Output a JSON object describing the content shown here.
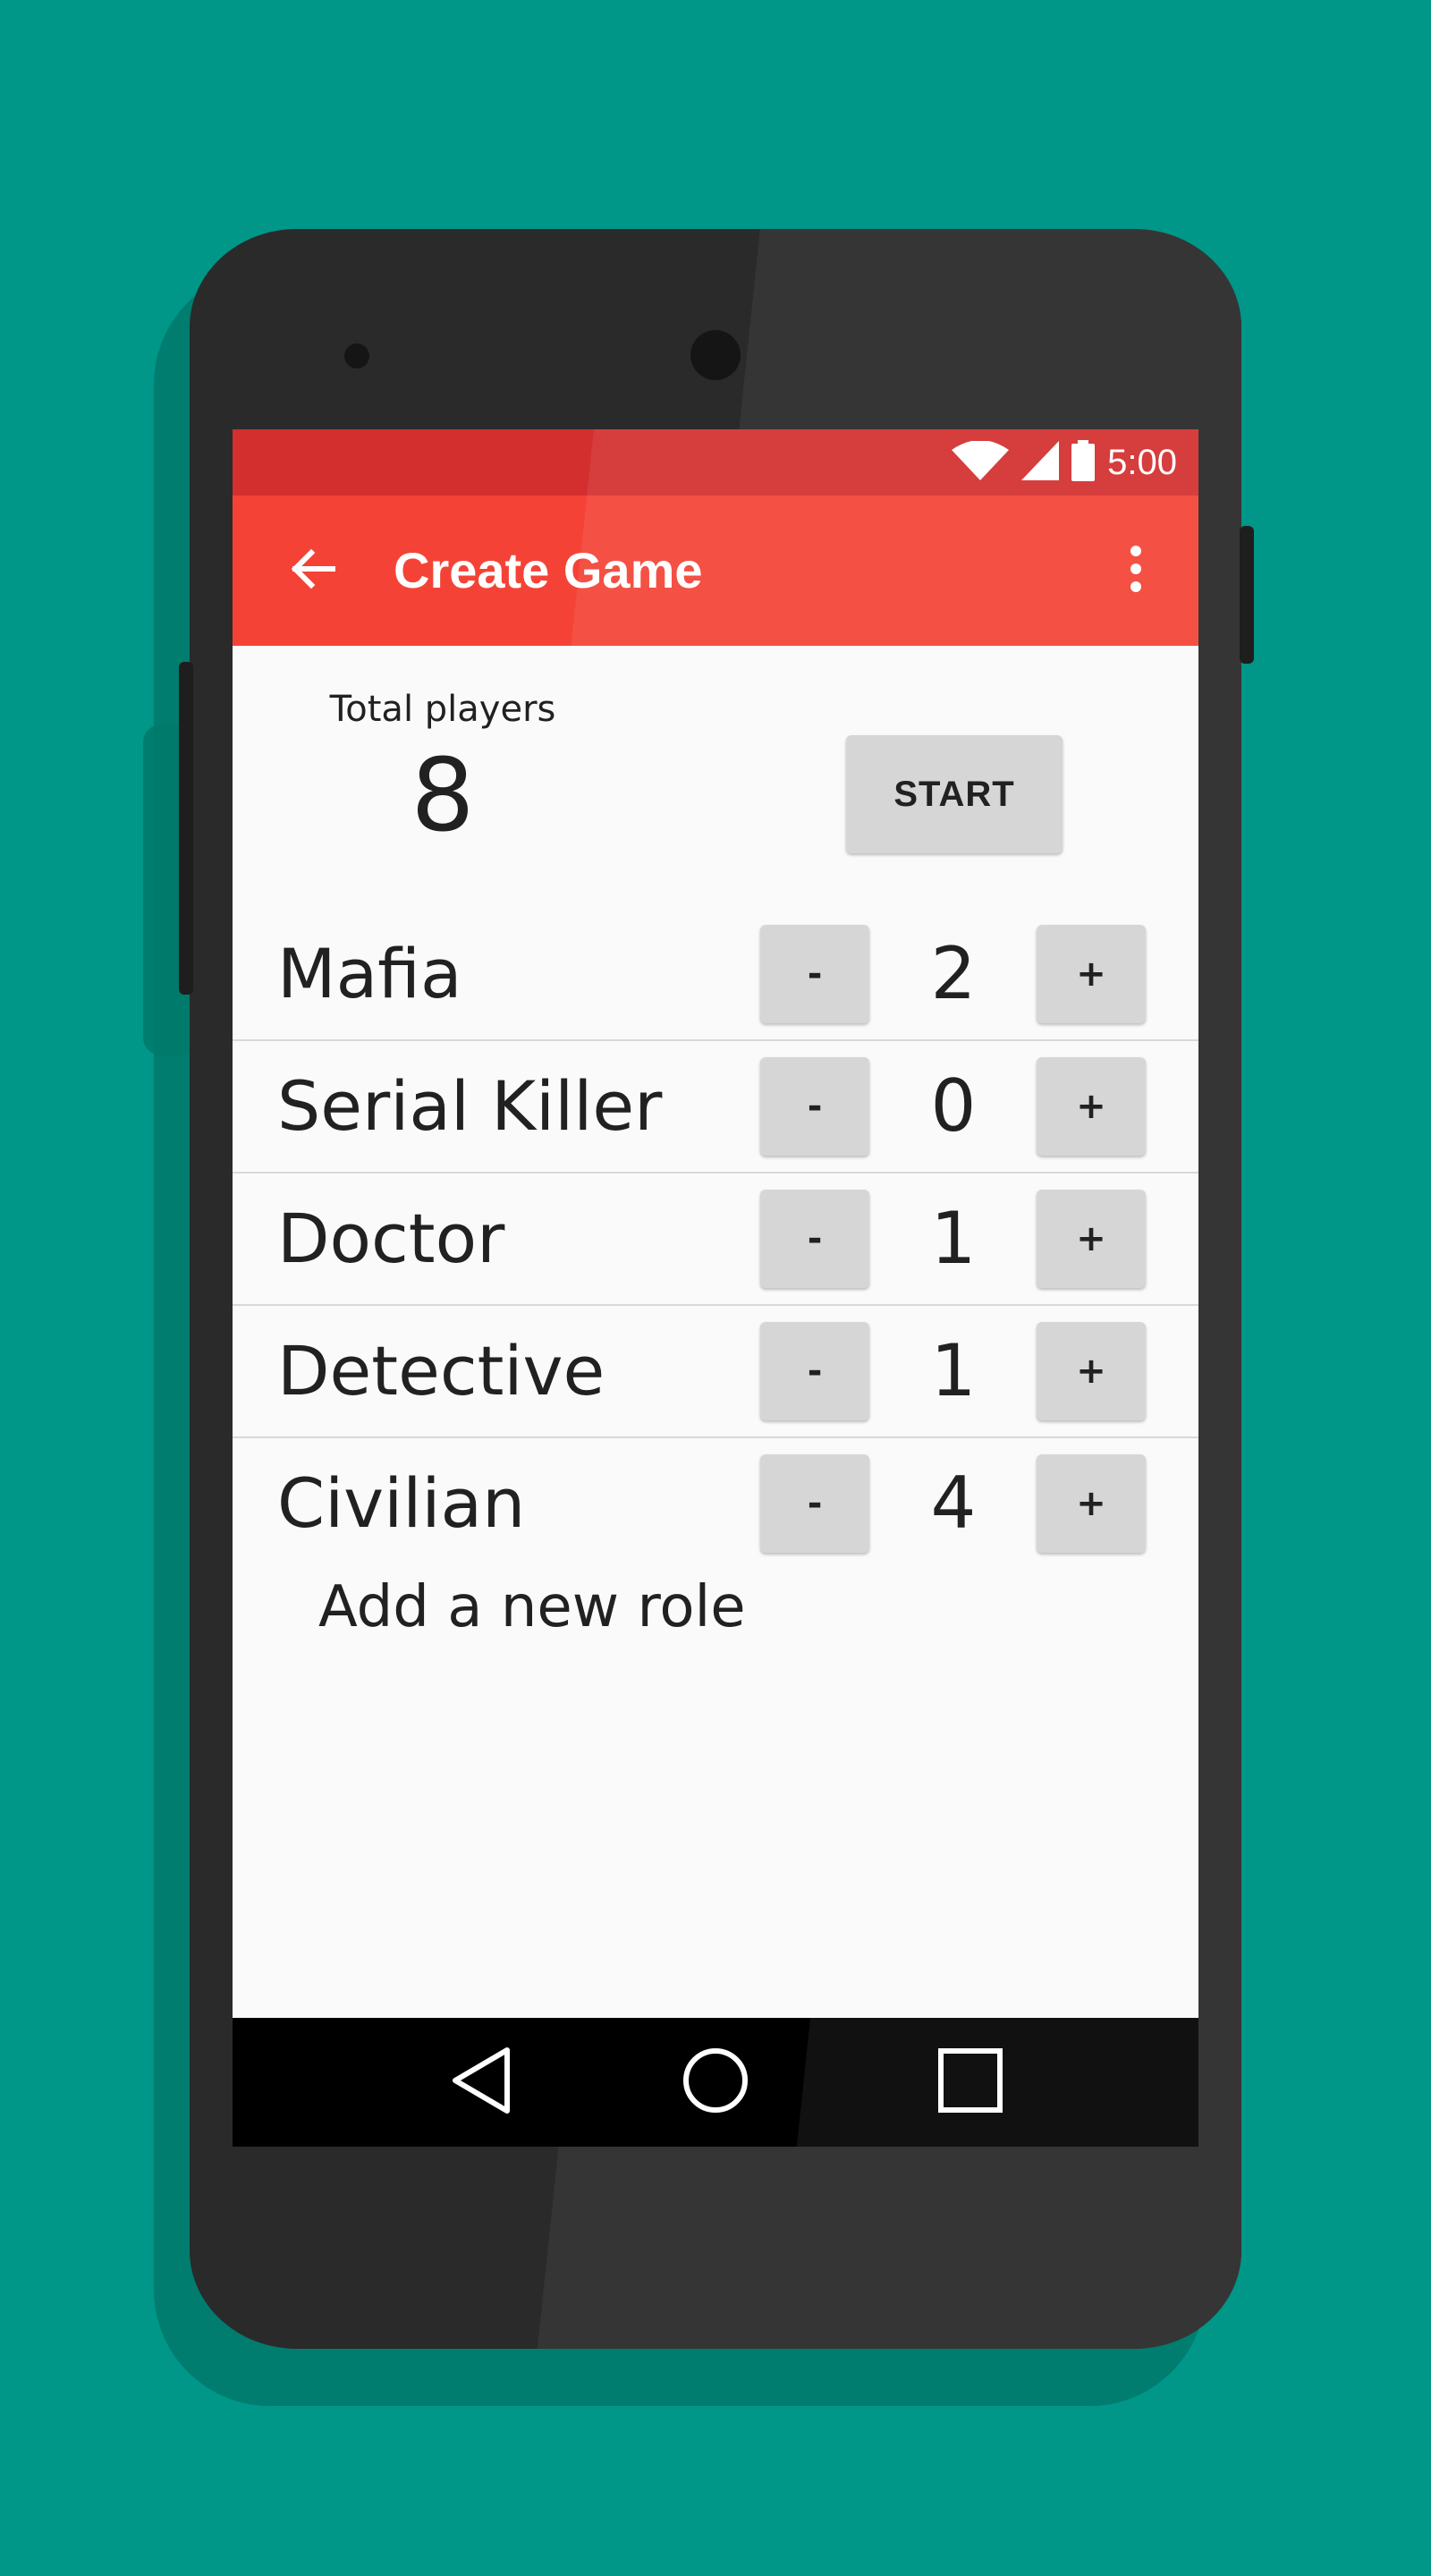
{
  "status_bar": {
    "time": "5:00",
    "icons": [
      "wifi-icon",
      "signal-icon",
      "battery-icon"
    ],
    "color": "#d32f2f"
  },
  "toolbar": {
    "title": "Create Game",
    "back_icon": "arrow-back-icon",
    "more_icon": "more-vert-icon",
    "color": "#f44336"
  },
  "summary": {
    "total_label": "Total players",
    "total_value": "8",
    "start_label": "START"
  },
  "roles": [
    {
      "name": "Mafia",
      "count": "2",
      "minus": "-",
      "plus": "+"
    },
    {
      "name": "Serial Killer",
      "count": "0",
      "minus": "-",
      "plus": "+"
    },
    {
      "name": "Doctor",
      "count": "1",
      "minus": "-",
      "plus": "+"
    },
    {
      "name": "Detective",
      "count": "1",
      "minus": "-",
      "plus": "+"
    },
    {
      "name": "Civilian",
      "count": "4",
      "minus": "-",
      "plus": "+"
    }
  ],
  "add_role_label": "Add a new role",
  "nav_bar": {
    "icons": [
      "back-triangle-icon",
      "home-circle-icon",
      "recents-square-icon"
    ]
  },
  "colors": {
    "background": "#009688",
    "phone_body": "#2a2a2a"
  }
}
